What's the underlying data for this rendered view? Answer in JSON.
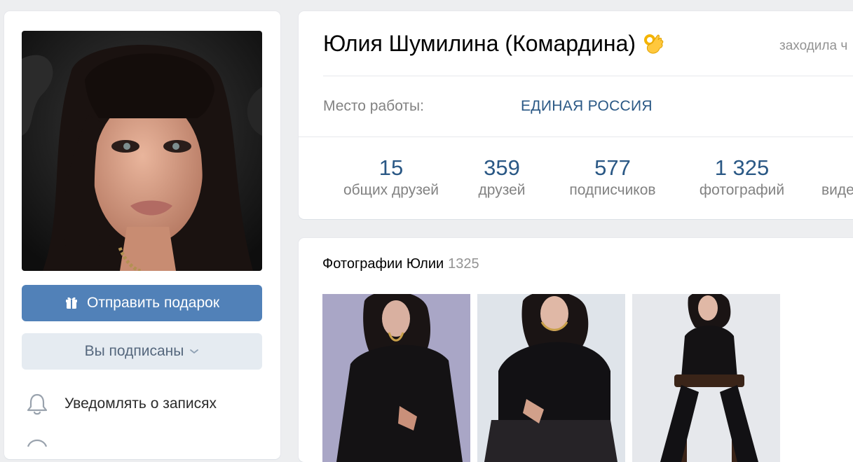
{
  "profile": {
    "name": "Юлия Шумилина (Комардина)",
    "emoji": "ok-hand-emoji",
    "last_seen": "заходила ч",
    "work_label": "Место работы:",
    "work_value": "ЕДИНАЯ РОССИЯ"
  },
  "actions": {
    "gift_label": "Отправить подарок",
    "subscribed_label": "Вы подписаны",
    "notify_label": "Уведомлять о записях"
  },
  "stats": [
    {
      "num": "15",
      "label": "общих друзей"
    },
    {
      "num": "359",
      "label": "друзей"
    },
    {
      "num": "577",
      "label": "подписчиков"
    },
    {
      "num": "1 325",
      "label": "фотографий"
    },
    {
      "num": "",
      "label": "виде"
    }
  ],
  "photos": {
    "title": "Фотографии Юлии",
    "count": "1325"
  },
  "colors": {
    "accent": "#5181b8",
    "link": "#2a5885",
    "muted": "#828282",
    "background": "#edeef0"
  },
  "icons": [
    "gift-icon",
    "chevron-down-icon",
    "bell-icon",
    "ok-hand-emoji"
  ]
}
